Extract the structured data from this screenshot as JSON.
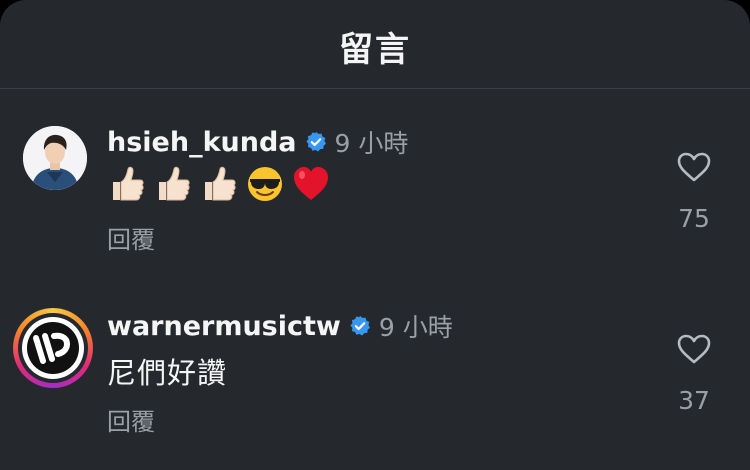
{
  "header": {
    "title": "留言"
  },
  "comments": [
    {
      "username": "hsieh_kunda",
      "verified": true,
      "time": "9 小時",
      "emojis": [
        "thumbs-up",
        "thumbs-up",
        "thumbs-up",
        "smiling-face-with-sunglasses",
        "red-heart"
      ],
      "reply_label": "回覆",
      "like_count": "75",
      "avatar": "profile-photo"
    },
    {
      "username": "warnermusictw",
      "verified": true,
      "time": "9 小時",
      "text": "尼們好讚",
      "reply_label": "回覆",
      "like_count": "37",
      "avatar": "warner-music-logo"
    }
  ],
  "colors": {
    "background": "#25292e",
    "primary_text": "#f5f5f5",
    "secondary_text": "#9aa0a6",
    "verified_badge": "#3897f0"
  }
}
